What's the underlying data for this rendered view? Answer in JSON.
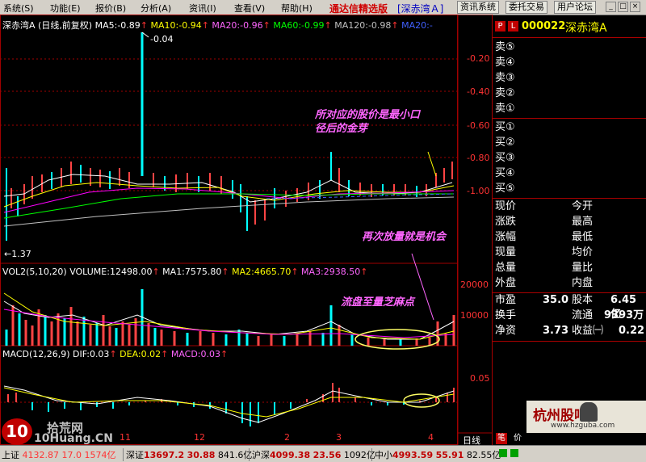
{
  "menu": [
    "系统(S)",
    "功能(E)",
    "报价(B)",
    "分析(A)",
    "资讯(I)",
    "查看(V)",
    "帮助(H)"
  ],
  "app_title": "通达信精选版",
  "stock_tag": "[深赤湾Ａ]",
  "toolbar": [
    "资讯系统",
    "委托交易",
    "用户论坛"
  ],
  "price_header": {
    "name": "深赤湾A (日线,前复权)",
    "ma5": "MA5:-0.89",
    "ma10": "MA10:-0.94",
    "ma20": "MA20:-0.96",
    "ma60": "MA60:-0.99",
    "ma120": "MA120:-0.98",
    "ma2x": "MA20:-"
  },
  "price_axis": [
    "-0.20",
    "-0.40",
    "-0.60",
    "-0.80",
    "-1.00"
  ],
  "price_marks": {
    "high": "-0.04",
    "low": "←1.37"
  },
  "vol_header": {
    "vol": "VOL2(5,10,20)",
    "volume": "VOLUME:12498.00",
    "ma1": "MA1:7575.80",
    "ma2": "MA2:4665.70",
    "ma3": "MA3:2938.50"
  },
  "vol_axis": [
    "20000",
    "10000"
  ],
  "macd_header": {
    "macd": "MACD(12,26,9)",
    "dif": "DIF:0.03",
    "dea": "DEA:0.02",
    "macd_val": "MACD:0.03"
  },
  "macd_axis": [
    "0.05"
  ],
  "time_axis": [
    "11",
    "12",
    "2",
    "3",
    "4"
  ],
  "annotations": {
    "a1_line1": "所对应的股价是最小口",
    "a1_line2": "径后的金芽",
    "a2": "再次放量就是机会",
    "a3": "流盘至量芝麻点"
  },
  "quote": {
    "code": "000022",
    "name": "深赤湾A",
    "sell": [
      "卖⑤",
      "卖④",
      "卖③",
      "卖②",
      "卖①"
    ],
    "buy": [
      "买①",
      "买②",
      "买③",
      "买④",
      "买⑤"
    ],
    "left_labels": [
      "现价",
      "涨跌",
      "涨幅",
      "现量",
      "总量",
      "外盘"
    ],
    "right_labels": [
      "今开",
      "最高",
      "最低",
      "均价",
      "量比",
      "内盘"
    ],
    "pe_label": "市盈",
    "pe_value": "35.0",
    "share_label": "股本",
    "share_value": "6.45亿",
    "turnover_label": "换手",
    "float_label": "流通",
    "float_value": "9393万",
    "nav_label": "净资",
    "nav_value": "3.73",
    "eps_label": "收益㈠",
    "eps_value": "0.22"
  },
  "tabs": [
    "日线",
    "笔",
    "价"
  ],
  "watermark_left": {
    "brand": "拾荒网",
    "url": "10Huang.CN"
  },
  "watermark_right": {
    "brand": "杭州股吧",
    "url": "www.hzguba.com"
  },
  "bottom": {
    "sh_label": "上证",
    "sh_text": "4132.87 17.0 1574亿",
    "sz_label": "深证",
    "sz_idx": "13697.2",
    "sz_chg": "30.88",
    "sz_amt": "841.6亿",
    "hs_label": "沪深",
    "hs_idx": "4099.38",
    "hs_chg": "23.56",
    "hs_amt": "1092亿",
    "zx_label": "中小",
    "zx_idx": "4993.59",
    "zx_chg": "55.91",
    "zx_amt": "82.55亿"
  }
}
